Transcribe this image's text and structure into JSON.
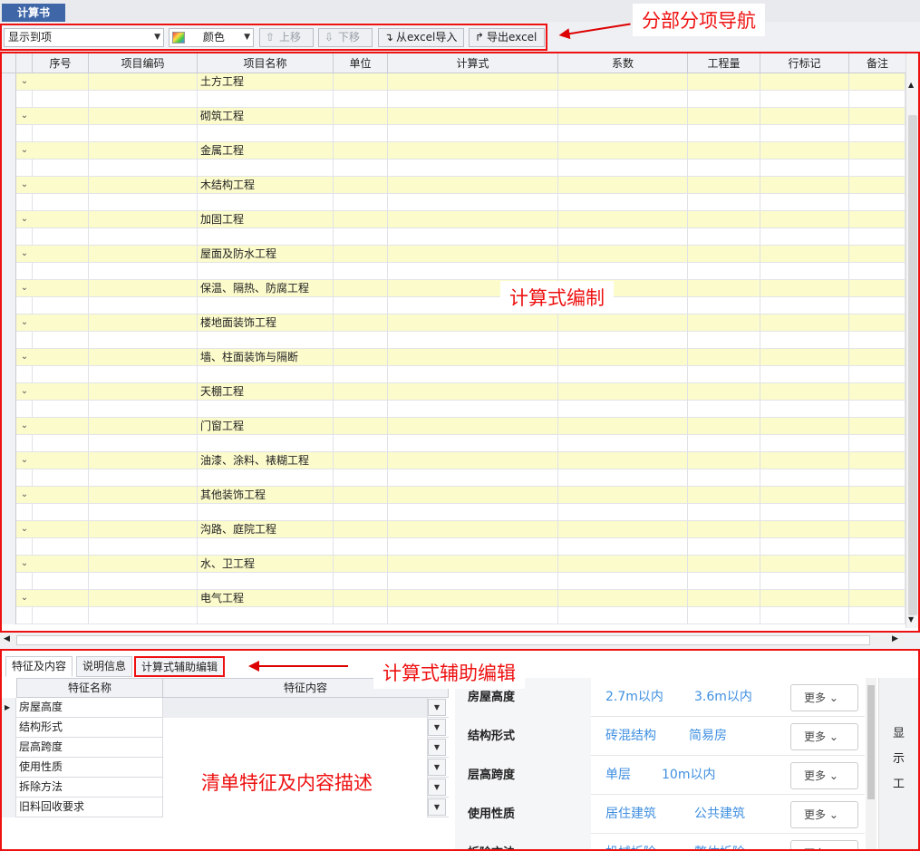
{
  "window_tab": "计算书",
  "toolbar": {
    "display_select": "显示到项",
    "color_label": "颜色",
    "move_up": "上移",
    "move_down": "下移",
    "import_excel": "从excel导入",
    "export_excel": "导出excel"
  },
  "annotations": {
    "nav": "分部分项导航",
    "formula_edit": "计算式编制",
    "aux_edit": "计算式辅助编辑",
    "feature_desc": "清单特征及内容描述"
  },
  "grid": {
    "columns": [
      "序号",
      "项目编码",
      "项目名称",
      "单位",
      "计算式",
      "系数",
      "工程量",
      "行标记",
      "备注"
    ],
    "rows": [
      "土方工程",
      "砌筑工程",
      "金属工程",
      "木结构工程",
      "加固工程",
      "屋面及防水工程",
      "保温、隔热、防腐工程",
      "楼地面装饰工程",
      "墙、柱面装饰与隔断",
      "天棚工程",
      "门窗工程",
      "油漆、涂料、裱糊工程",
      "其他装饰工程",
      "沟路、庭院工程",
      "水、卫工程",
      "电气工程"
    ]
  },
  "bottom_tabs": [
    "特征及内容",
    "说明信息",
    "计算式辅助编辑"
  ],
  "feature_table": {
    "headers": [
      "特征名称",
      "特征内容"
    ],
    "rows": [
      "房屋高度",
      "结构形式",
      "层高跨度",
      "使用性质",
      "拆除方法",
      "旧料回收要求"
    ]
  },
  "attr_panel": [
    {
      "name": "房屋高度",
      "opt1": "2.7m以内",
      "opt2": "3.6m以内",
      "more": "更多"
    },
    {
      "name": "结构形式",
      "opt1": "砖混结构",
      "opt2": "简易房",
      "more": "更多"
    },
    {
      "name": "层高跨度",
      "opt1": "单层",
      "opt2": "10m以内",
      "more": "更多"
    },
    {
      "name": "使用性质",
      "opt1": "居住建筑",
      "opt2": "公共建筑",
      "more": "更多"
    },
    {
      "name": "拆除方法",
      "opt1": "机械拆除",
      "opt2": "整体拆除",
      "more": "更多"
    }
  ],
  "side_button": [
    "显",
    "示",
    "工"
  ]
}
